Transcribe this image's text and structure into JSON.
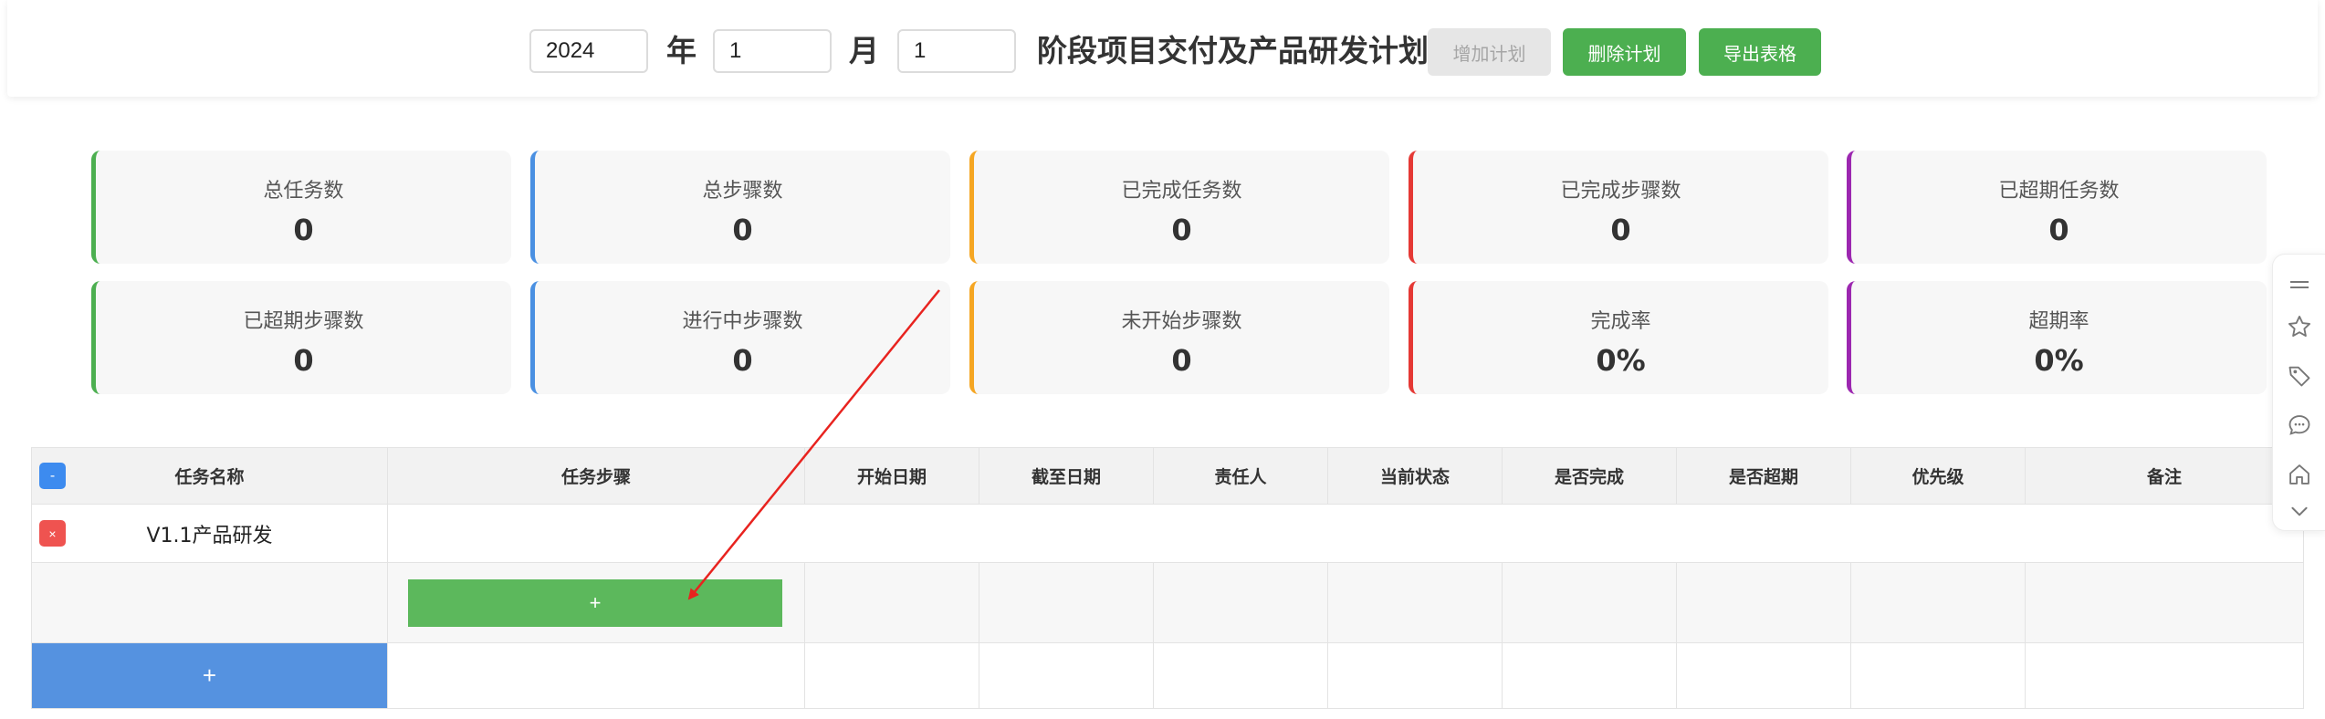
{
  "header": {
    "year_value": "2024",
    "year_label": "年",
    "month_value": "1",
    "month_label": "月",
    "stage_value": "1",
    "title": "阶段项目交付及产品研发计划",
    "add_plan_label": "增加计划",
    "delete_plan_label": "删除计划",
    "export_label": "导出表格"
  },
  "stats": [
    {
      "label": "总任务数",
      "value": "0",
      "color": "#4caf50"
    },
    {
      "label": "总步骤数",
      "value": "0",
      "color": "#4a90e2"
    },
    {
      "label": "已完成任务数",
      "value": "0",
      "color": "#f5a623"
    },
    {
      "label": "已完成步骤数",
      "value": "0",
      "color": "#e53935"
    },
    {
      "label": "已超期任务数",
      "value": "0",
      "color": "#9c27b0"
    },
    {
      "label": "已超期步骤数",
      "value": "0",
      "color": "#4caf50"
    },
    {
      "label": "进行中步骤数",
      "value": "0",
      "color": "#4a90e2"
    },
    {
      "label": "未开始步骤数",
      "value": "0",
      "color": "#f5a623"
    },
    {
      "label": "完成率",
      "value": "0%",
      "color": "#e53935"
    },
    {
      "label": "超期率",
      "value": "0%",
      "color": "#9c27b0"
    }
  ],
  "table": {
    "collapse_label": "-",
    "headers": [
      "任务名称",
      "任务步骤",
      "开始日期",
      "截至日期",
      "责任人",
      "当前状态",
      "是否完成",
      "是否超期",
      "优先级",
      "备注"
    ],
    "tasks": [
      {
        "name": "V1.1产品研发",
        "delete_label": "×"
      }
    ],
    "add_step_label": "+",
    "add_task_label": "+"
  },
  "side_toolbar": {
    "icons": [
      "menu-icon",
      "star-icon",
      "tag-icon",
      "comment-icon",
      "home-icon",
      "chevron-down-icon"
    ]
  },
  "annotation": {
    "arrow_color": "#e8231f"
  }
}
